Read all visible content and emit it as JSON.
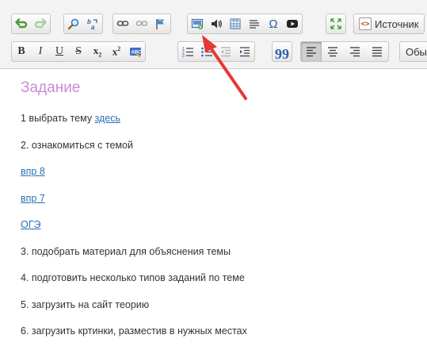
{
  "toolbar": {
    "row1": {
      "undo_icon": "undo-icon",
      "redo_icon": "redo-icon",
      "find_icon": "find-icon",
      "replace_icon": "replace-icon",
      "link_icon": "link-icon",
      "unlink_icon": "unlink-icon",
      "anchor_icon": "anchor-flag-icon",
      "image_icon": "image-icon",
      "audio_icon": "audio-icon",
      "table_icon": "table-icon",
      "hr_icon": "horizontal-rule-icon",
      "special_char": "Ω",
      "youtube_icon": "youtube-icon",
      "maximize_icon": "maximize-icon",
      "source_label": "Источник"
    },
    "row2": {
      "bold": "B",
      "italic": "I",
      "underline": "U",
      "strike": "S",
      "subscript_base": "x",
      "subscript_sub": "2",
      "superscript_base": "x",
      "superscript_sup": "2",
      "remove_format_icon": "remove-format-icon",
      "numbered_list_icon": "numbered-list-icon",
      "bulleted_list_icon": "bulleted-list-icon",
      "outdent_icon": "outdent-icon",
      "indent_icon": "indent-icon",
      "blockquote": "99",
      "align_left_icon": "align-left-icon",
      "align_center_icon": "align-center-icon",
      "align_right_icon": "align-right-icon",
      "justify_icon": "justify-icon",
      "format_value": "Обычн"
    },
    "accent_color": "#e53935"
  },
  "document": {
    "heading": "Задание",
    "items": [
      {
        "text": "1 выбрать тему ",
        "link": "здесь "
      },
      {
        "text": "2. ознакомиться с темой"
      },
      {
        "link": "впр 8"
      },
      {
        "link": "впр 7"
      },
      {
        "link": "ОГЭ"
      },
      {
        "text": "3. подобрать материал для объяснения темы"
      },
      {
        "text": "4. подготовить несколько типов заданий по теме"
      },
      {
        "text": "5. загрузить на сайт теорию"
      },
      {
        "text": "6. загрузить кртинки, разместив в нужных местах"
      }
    ],
    "heading_color": "#c98bd9",
    "link_color": "#2a6fb5"
  }
}
